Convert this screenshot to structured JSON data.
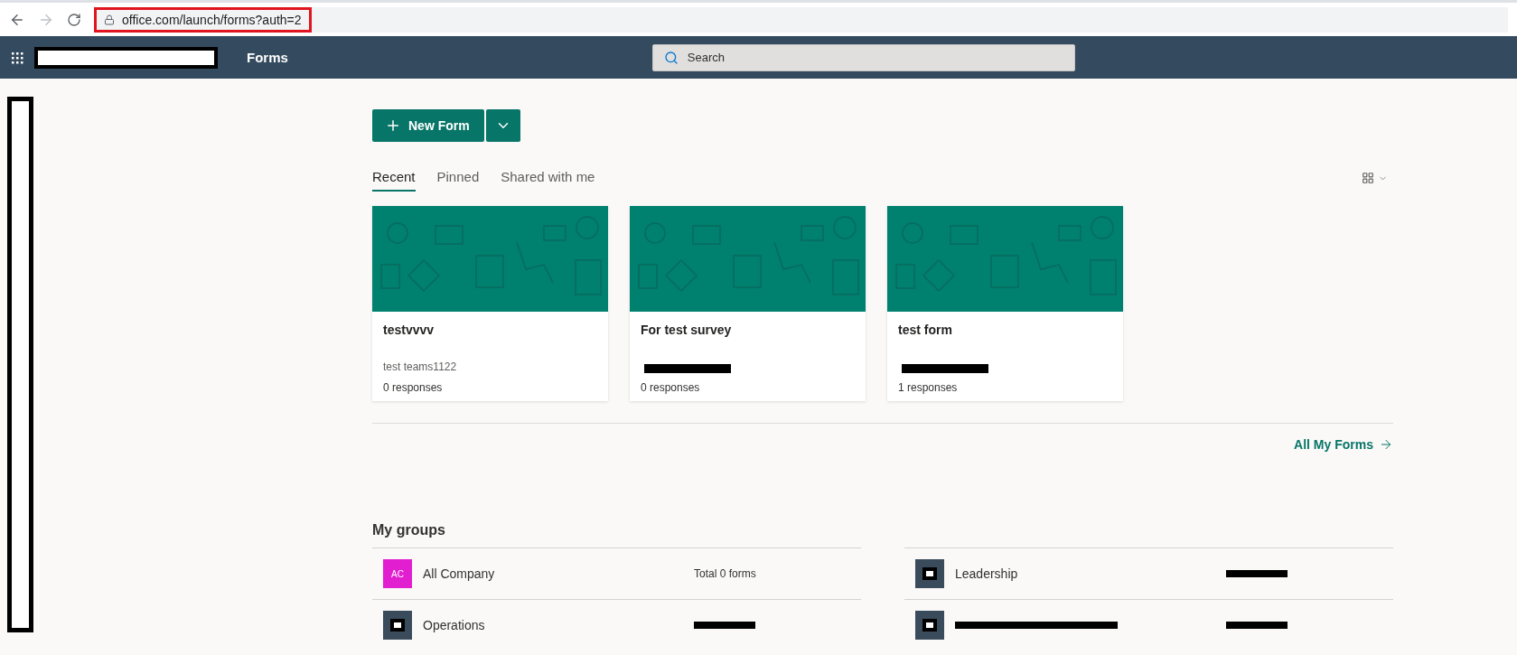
{
  "browser": {
    "url": "office.com/launch/forms?auth=2",
    "forward_disabled": true
  },
  "header": {
    "app_name": "Forms",
    "search": {
      "placeholder": "Search"
    }
  },
  "new_form_button": {
    "label": "New Form"
  },
  "tabs": [
    {
      "label": "Recent",
      "selected": true
    },
    {
      "label": "Pinned",
      "selected": false
    },
    {
      "label": "Shared with me",
      "selected": false
    }
  ],
  "forms": [
    {
      "title": "testvvvv",
      "owner": "test teams1122",
      "responses": "0 responses"
    },
    {
      "title": "For test survey",
      "responses": "0 responses"
    },
    {
      "title": "test form",
      "responses": "1 responses"
    }
  ],
  "all_forms_link": "All My Forms",
  "groups": {
    "title": "My groups",
    "items": [
      {
        "name": "All Company",
        "initials": "AC",
        "count": "Total 0 forms",
        "color": "#e21fd0"
      },
      {
        "name": "Leadership",
        "color": "#3a4b5c"
      },
      {
        "name": "Operations",
        "color": "#3a4b5c"
      },
      {
        "color": "#3a4b5c"
      }
    ]
  }
}
